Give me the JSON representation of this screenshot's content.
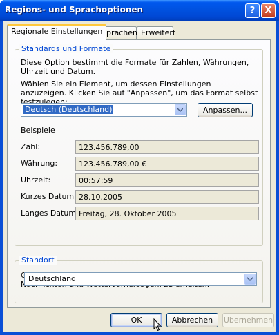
{
  "window": {
    "title": "Regions- und Sprachoptionen",
    "help_glyph": "?",
    "close_glyph": "X"
  },
  "tabs": [
    {
      "label": "Regionale Einstellungen",
      "active": true
    },
    {
      "label": "Sprachen",
      "active": false
    },
    {
      "label": "Erweitert",
      "active": false
    }
  ],
  "standards": {
    "legend": "Standards und Formate",
    "description": "Diese Option bestimmt die Formate für Zahlen, Währungen, Uhrzeit und Datum.",
    "instruction": "Wählen Sie ein Element, um dessen Einstellungen anzuzeigen. Klicken Sie auf \"Anpassen\", um das Format selbst festzulegen:",
    "format_select": "Deutsch (Deutschland)",
    "customize_button": "Anpassen...",
    "examples_heading": "Beispiele",
    "examples": [
      {
        "label": "Zahl:",
        "value": "123.456.789,00"
      },
      {
        "label": "Währung:",
        "value": "123.456.789,00 €"
      },
      {
        "label": "Uhrzeit:",
        "value": "00:57:59"
      },
      {
        "label": "Kurzes Datum:",
        "value": "28.10.2005"
      },
      {
        "label": "Langes Datum:",
        "value": "Freitag, 28. Oktober 2005"
      }
    ]
  },
  "location": {
    "legend": "Standort",
    "description": "Geben Sie Ihren Standort ein, um lokale Informationen, wie Nachrichten und Wettervorhersagen, zu erhalten:",
    "location_select": "Deutschland"
  },
  "buttons": {
    "ok": "OK",
    "cancel": "Abbrechen",
    "apply": "Übernehmen"
  },
  "colors": {
    "titlebar": "#0054e3",
    "legend_text": "#0046d5",
    "selection": "#316ac5",
    "active_tab_highlight": "#ffc83c"
  }
}
